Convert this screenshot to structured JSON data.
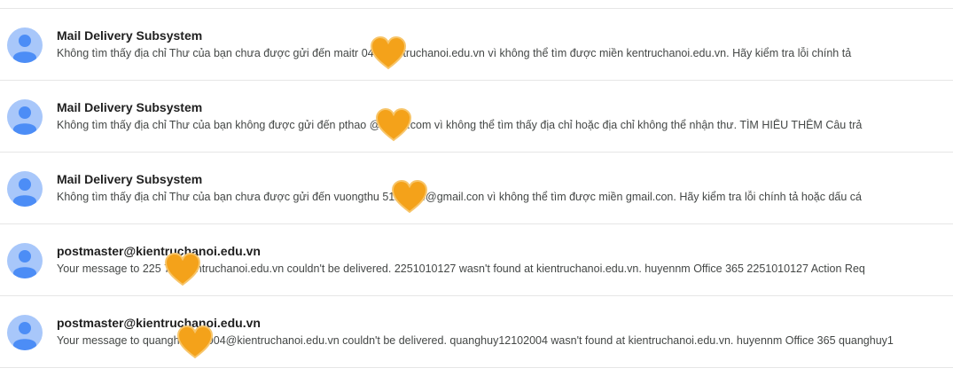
{
  "icons": {
    "avatar": "default-person-avatar-icon",
    "redaction": "orange-heart-sticker-icon"
  },
  "colors": {
    "avatar_bg": "#a8c7fa",
    "avatar_fg": "#4c8df6",
    "heart": "#f4a21a"
  },
  "messages": [
    {
      "sender": "Mail Delivery Subsystem",
      "snippet": "Không tìm thấy địa chỉ Thư của bạn chưa được gửi đến maitr        04@kentruchanoi.edu.vn vì không thể tìm được miền kentruchanoi.edu.vn. Hãy kiểm tra lỗi chính tả"
    },
    {
      "sender": "Mail Delivery Subsystem",
      "snippet": "Không tìm thấy địa chỉ Thư của bạn không được gửi đến pthao          @gmail.com vì không thể tìm thấy địa chỉ hoặc địa chỉ không thể nhận thư. TÌM HIỂU THÊM Câu trả"
    },
    {
      "sender": "Mail Delivery Subsystem",
      "snippet": "Không tìm thấy địa chỉ Thư của bạn chưa được gửi đến vuongthu          5122004@gmail.con vì không thể tìm được miền gmail.con. Hãy kiểm tra lỗi chính tả hoặc dấu cá"
    },
    {
      "sender": "postmaster@kientruchanoi.edu.vn",
      "snippet": "Your message to 225        7@kientruchanoi.edu.vn couldn't be delivered. 2251010127 wasn't found at kientruchanoi.edu.vn. huyennm Office 365 2251010127 Action Req"
    },
    {
      "sender": "postmaster@kientruchanoi.edu.vn",
      "snippet": "Your message to quangh       2102004@kientruchanoi.edu.vn couldn't be delivered. quanghuy12102004 wasn't found at kientruchanoi.edu.vn. huyennm Office 365 quanghuy1"
    }
  ]
}
